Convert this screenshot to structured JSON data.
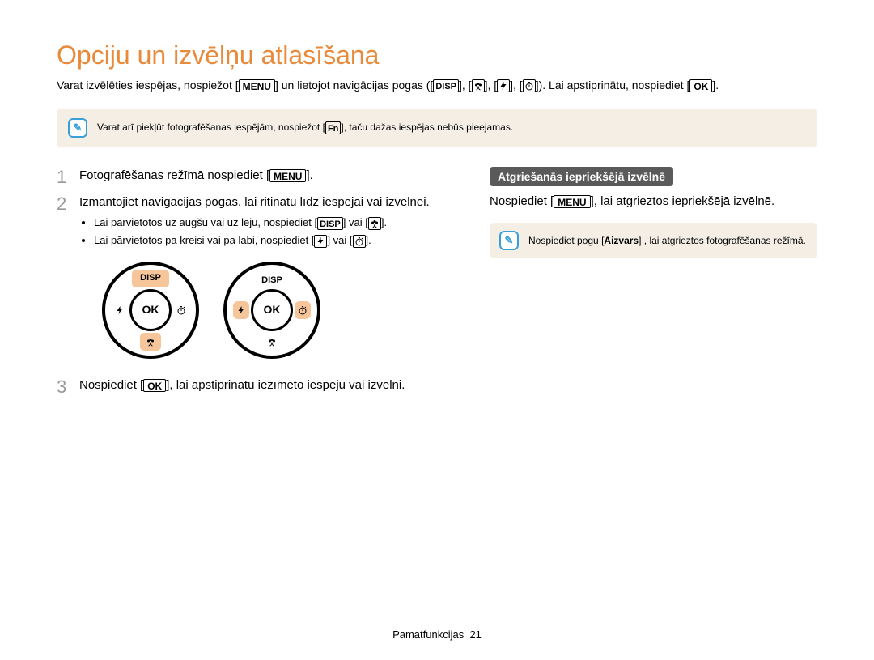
{
  "title": "Opciju un izvēlņu atlasīšana",
  "intro": {
    "a": "Varat izvēlēties iespējas, nospiežot [",
    "menu": "MENU",
    "b": "] un lietojot navigācijas pogas ([",
    "disp": "DISP",
    "c": "], [",
    "d": "], [",
    "e": "], [",
    "f": "]). Lai apstiprinātu, nospiediet [",
    "ok": "OK",
    "g": "]."
  },
  "tip1": {
    "a": "Varat arī piekļūt fotografēšanas iespējām, nospiežot [",
    "fn": "Fn",
    "b": "], taču dažas iespējas nebūs pieejamas."
  },
  "steps": {
    "s1a": "Fotografēšanas režīmā nospiediet [",
    "s1menu": "MENU",
    "s1b": "].",
    "s2": "Izmantojiet navigācijas pogas, lai ritinātu līdz iespējai vai izvēlnei.",
    "b1a": "Lai pārvietotos uz augšu vai uz leju, nospiediet [",
    "b1disp": "DISP",
    "b1b": "] vai [",
    "b1c": "].",
    "b2a": "Lai pārvietotos pa kreisi vai pa labi, nospiediet [",
    "b2b": "] vai [",
    "b2c": "].",
    "s3a": "Nospiediet [",
    "s3ok": "OK",
    "s3b": "], lai apstiprinātu iezīmēto iespēju vai izvēlni."
  },
  "dial": {
    "ok": "OK",
    "disp": "DISP"
  },
  "right": {
    "heading": "Atgriešanās iepriekšējā izvēlnē",
    "text_a": "Nospiediet [",
    "text_menu": "MENU",
    "text_b": "], lai atgrieztos iepriekšējā izvēlnē.",
    "tip_a": "Nospiediet pogu [",
    "tip_btn": "Aizvars",
    "tip_b": "] , lai atgrieztos fotografēšanas režīmā."
  },
  "footer": {
    "label": "Pamatfunkcijas",
    "page": "21"
  }
}
